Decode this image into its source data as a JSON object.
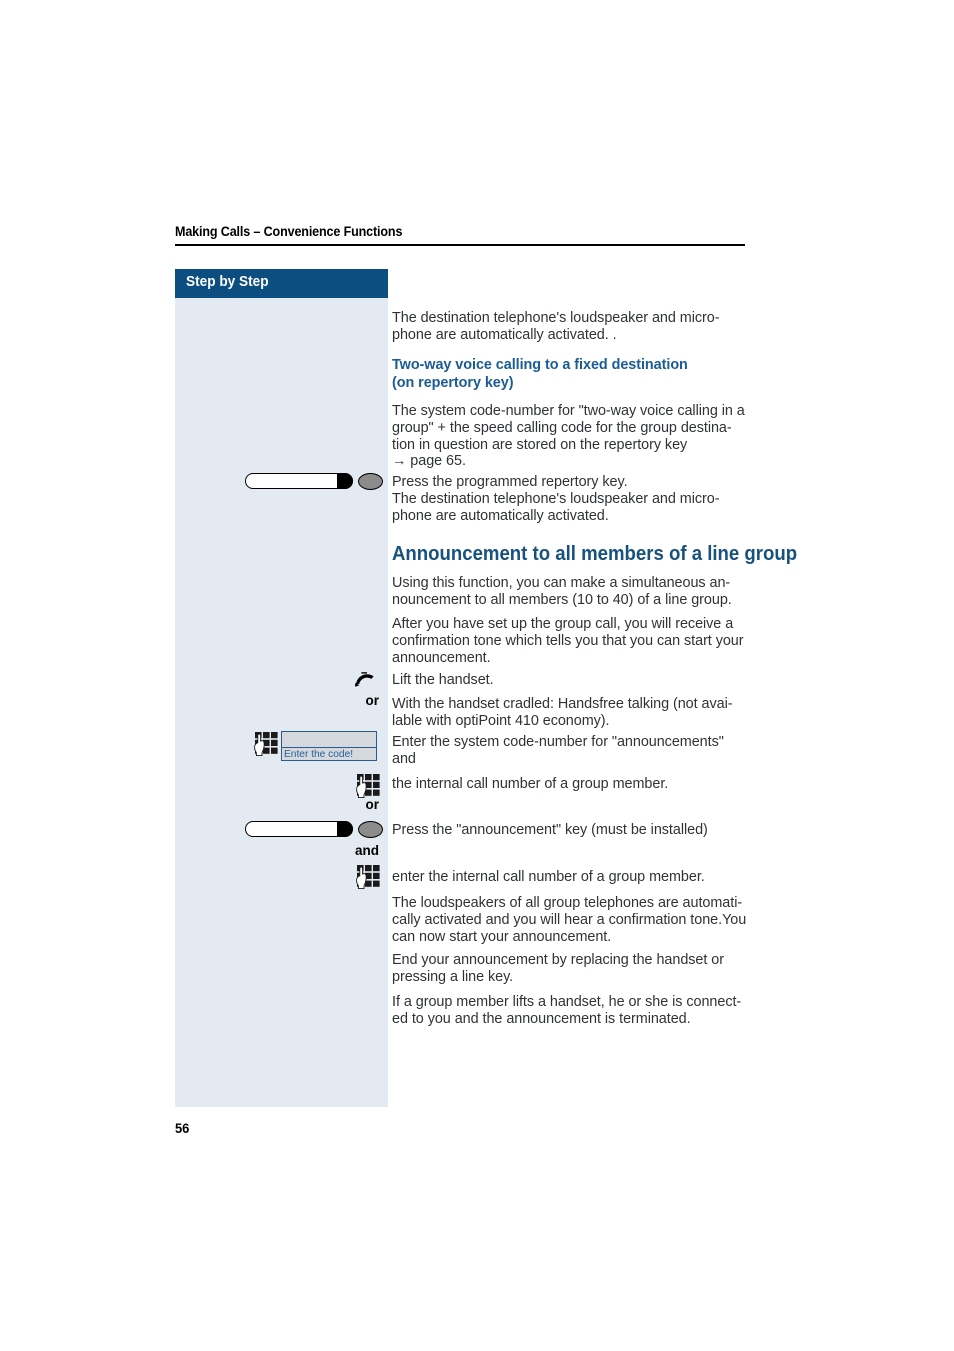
{
  "document": {
    "running_header": "Making Calls – Convenience Functions",
    "page_number": "56"
  },
  "sidebar": {
    "title": "Step by Step"
  },
  "content": {
    "intro_paragraph": "The destination telephone's loudspeaker and micro-\nphone are automatically activated. .",
    "subheading_twoway": "Two-way voice calling to a fixed destination\n(on repertory key)",
    "twoway_paragraph": "The system code-number for \"two-way voice calling in a\ngroup\" + the speed calling code for the group destina-\ntion in question are stored on the repertory key\n→ page 65.",
    "press_repertory_paragraph": "Press the programmed repertory key.\nThe destination telephone's loudspeaker and micro-\nphone are automatically activated.",
    "section_heading": "Announcement to all members of a line group",
    "using_function_paragraph": "Using this function, you can make a simultaneous an-\nnouncement to all members (10 to 40) of a line group.",
    "after_setup_paragraph": "After you have set up the group call, you will receive a\nconfirmation tone which tells you that you can start your\nannouncement.",
    "lift_handset": "Lift the handset.",
    "handsfree_paragraph": "With the handset cradled: Handsfree talking (not avai-\nlable with optiPoint 410 economy).",
    "enter_code_paragraph": "Enter the system code-number for \"announcements\"\nand",
    "internal_number_paragraph": "the internal call number of a group member.",
    "press_announcement_key": "Press the \"announcement\" key (must be installed)",
    "enter_internal_number_paragraph": "enter the internal call number of a group member.",
    "loudspeakers_paragraph": "The loudspeakers of all group telephones are automati-\ncally activated and you will hear a confirmation tone.You\ncan now start your announcement.",
    "end_announcement_paragraph": "End your announcement by replacing the handset or\npressing a line key.",
    "group_member_lifts_paragraph": "If a group member lifts a handset, he or she is connect-\ned to you and the announcement is terminated."
  },
  "display": {
    "prompt": "Enter the code!"
  },
  "connectors": {
    "or_1": "or",
    "or_2": "or",
    "and_1": "and"
  },
  "icons": {
    "repertory_key": "function-key-icon",
    "announcement_key": "function-key-icon",
    "handset": "lift-handset-icon",
    "keypad": "keypad-icon"
  },
  "colors": {
    "sidebar_header_bg": "#0d4e80",
    "sidebar_body_bg": "#e3eaf1",
    "heading_blue": "#17527f",
    "subheading_blue": "#1a5c93",
    "body_text": "#2f3336",
    "display_border": "#2c5c8f",
    "display_fill": "#d5d8dc",
    "display_text": "#26619c",
    "led_gray": "#8c8c8c"
  }
}
